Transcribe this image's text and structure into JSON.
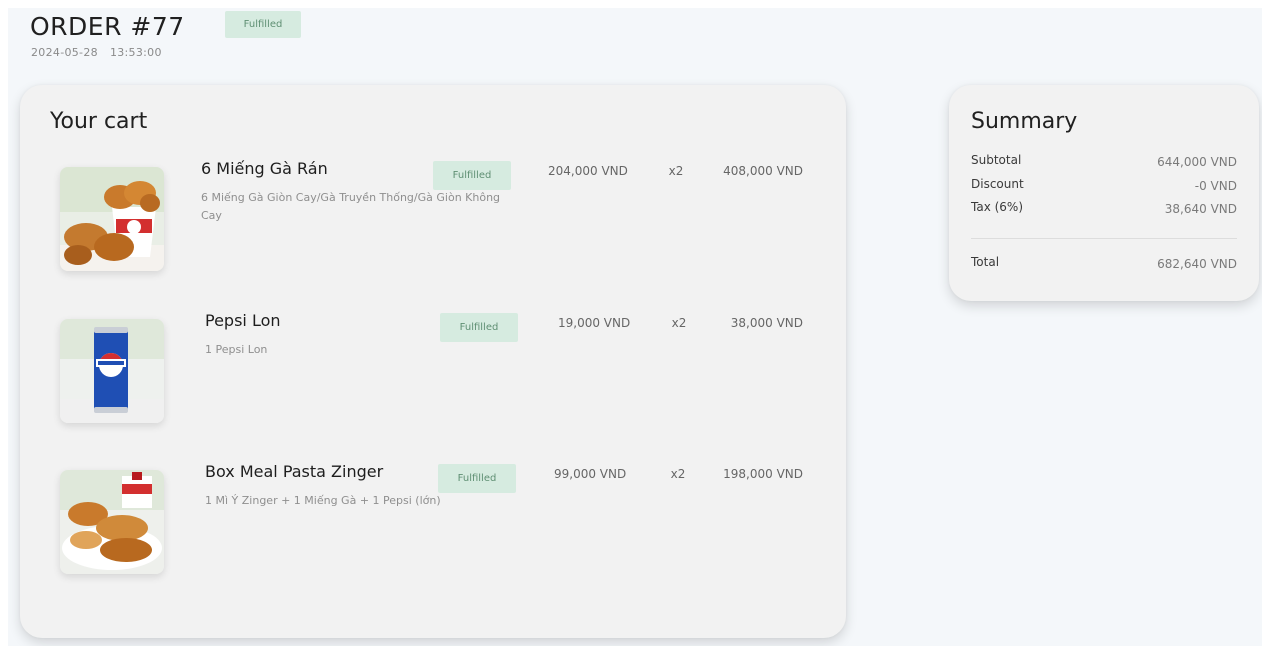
{
  "order": {
    "title": "ORDER #77",
    "date": "2024-05-28",
    "time": "13:53:00",
    "status": "Fulfilled"
  },
  "cart": {
    "title": "Your cart",
    "items": [
      {
        "name": "6 Miếng Gà Rán",
        "description": "6 Miếng Gà Giòn Cay/Gà Truyền Thống/Gà Giòn Không Cay",
        "status": "Fulfilled",
        "price": "204,000 VND",
        "qty": "x2",
        "total": "408,000 VND"
      },
      {
        "name": "Pepsi Lon",
        "description": "1 Pepsi Lon",
        "status": "Fulfilled",
        "price": "19,000 VND",
        "qty": "x2",
        "total": "38,000 VND"
      },
      {
        "name": "Box Meal Pasta Zinger",
        "description": "1 Mì Ý Zinger + 1 Miếng Gà + 1 Pepsi (lớn)",
        "status": "Fulfilled",
        "price": "99,000 VND",
        "qty": "x2",
        "total": "198,000 VND"
      }
    ]
  },
  "summary": {
    "title": "Summary",
    "subtotal_label": "Subtotal",
    "subtotal_value": "644,000 VND",
    "discount_label": "Discount",
    "discount_value": "-0 VND",
    "tax_label": "Tax (6%)",
    "tax_value": "38,640 VND",
    "total_label": "Total",
    "total_value": "682,640 VND"
  },
  "colors": {
    "badge_bg": "#d6ebe0",
    "badge_text": "#5f8f73",
    "card_bg": "#f2f2f2",
    "page_bg": "#f4f7fa"
  }
}
